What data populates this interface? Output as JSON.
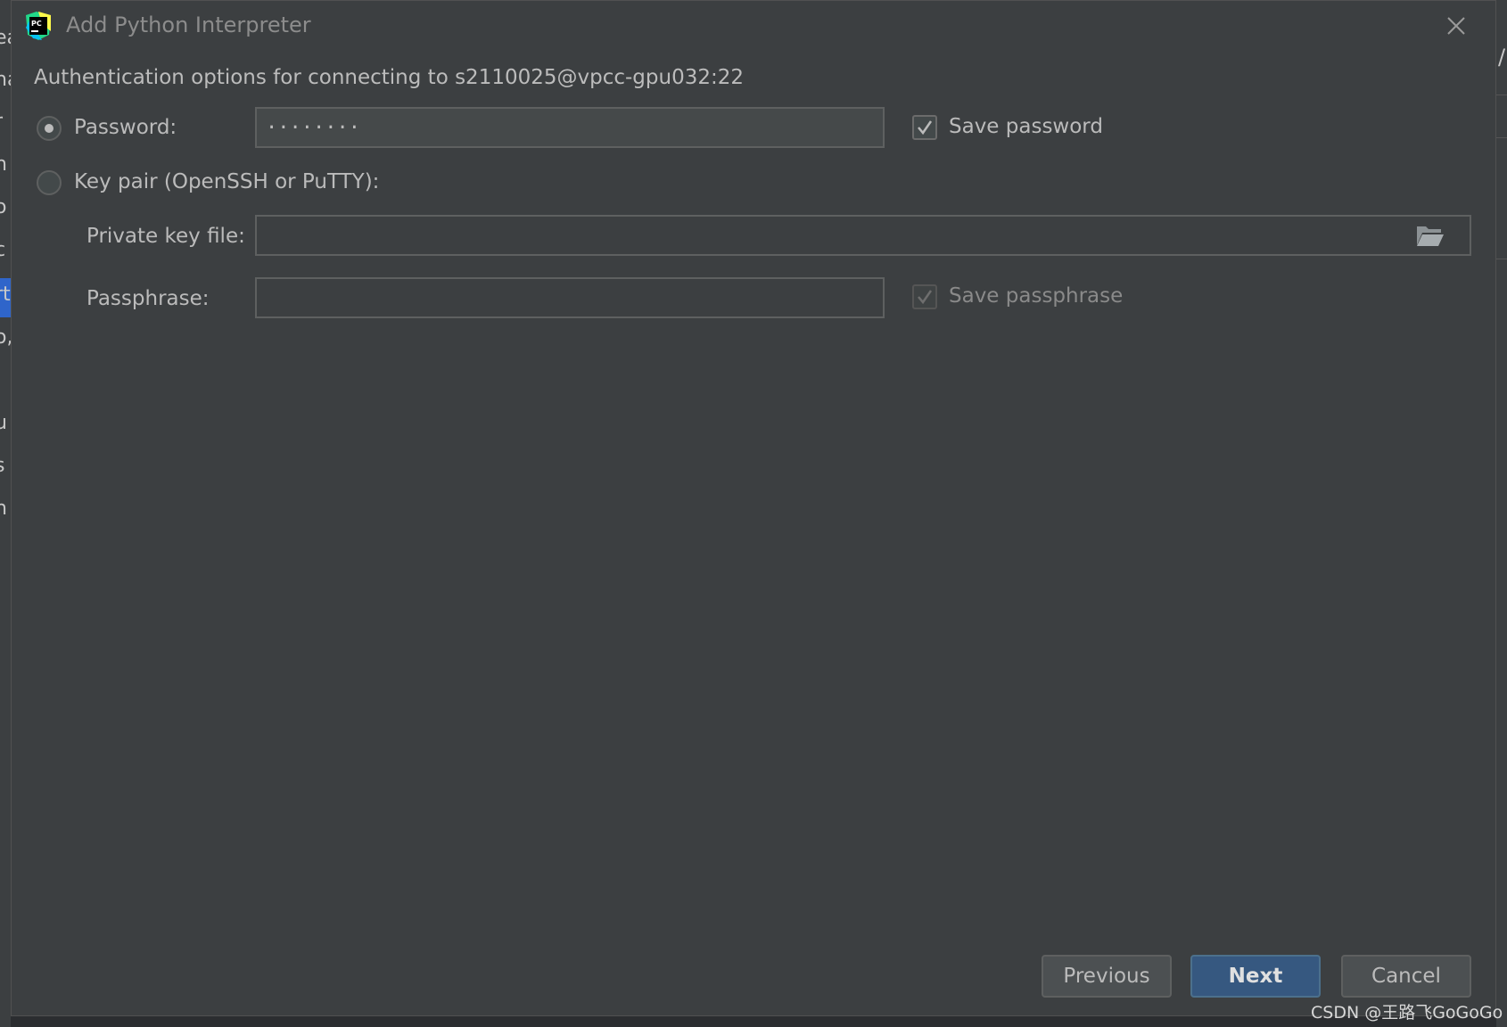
{
  "window": {
    "title": "Add Python Interpreter",
    "app_icon": "pycharm-icon",
    "close_icon": "close-icon"
  },
  "auth": {
    "heading": "Authentication options for connecting to s2110025@vpcc-gpu032:22",
    "password_option": {
      "label": "Password:",
      "selected": true,
      "value": "········"
    },
    "save_password": {
      "label": "Save password",
      "checked": true
    },
    "keypair_option": {
      "label": "Key pair (OpenSSH or PuTTY):",
      "selected": false
    },
    "private_key_file": {
      "label": "Private key file:",
      "value": ""
    },
    "browse_icon": "folder-icon",
    "passphrase": {
      "label": "Passphrase:",
      "value": ""
    },
    "save_passphrase": {
      "label": "Save passphrase",
      "checked": true,
      "enabled": false
    }
  },
  "buttons": {
    "previous": "Previous",
    "next": "Next",
    "cancel": "Cancel"
  },
  "background_fragments": {
    "left": [
      "ea",
      "ha",
      "r",
      "n",
      "o",
      "c",
      "rt",
      "o,",
      ",",
      "u",
      "s",
      "n"
    ],
    "right": "/p"
  },
  "watermark": "CSDN @王路飞GoGoGo",
  "colors": {
    "dialog_bg": "#3c3f41",
    "primary_button": "#365880",
    "selection_blue": "#2f65ca"
  }
}
